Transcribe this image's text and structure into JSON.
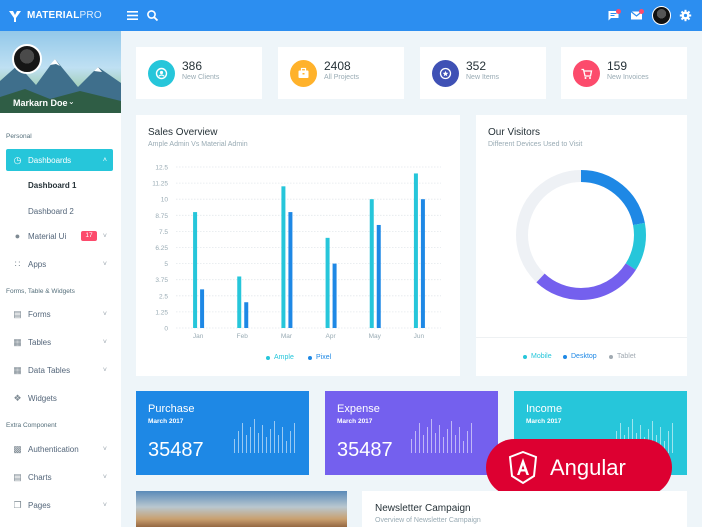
{
  "brand": {
    "name_bold": "MATERIAL",
    "name_light": "PRO"
  },
  "topbar": {
    "icons": [
      "hamburger-icon",
      "search-icon",
      "message-icon",
      "mail-icon",
      "avatar",
      "gear-icon"
    ]
  },
  "profile": {
    "name": "Markarn Doe"
  },
  "sidebar": {
    "section_personal": "Personal",
    "dashboards": "Dashboards",
    "dashboard1": "Dashboard 1",
    "dashboard2": "Dashboard 2",
    "material_ui": "Material Ui",
    "material_badge": "17",
    "apps": "Apps",
    "section_forms": "Forms, Table & Widgets",
    "forms": "Forms",
    "tables": "Tables",
    "data_tables": "Data Tables",
    "widgets": "Widgets",
    "section_extra": "Extra Component",
    "authentication": "Authentication",
    "charts": "Charts",
    "pages": "Pages"
  },
  "stats": [
    {
      "value": "386",
      "label": "New Clients",
      "color": "#26c6da"
    },
    {
      "value": "2408",
      "label": "All Projects",
      "color": "#ffb22b"
    },
    {
      "value": "352",
      "label": "New Items",
      "color": "#3f51b5"
    },
    {
      "value": "159",
      "label": "New Invoices",
      "color": "#fc4b6c"
    }
  ],
  "sales": {
    "title": "Sales Overview",
    "subtitle": "Ample Admin Vs Material Admin"
  },
  "visitors": {
    "title": "Our Visitors",
    "subtitle": "Different Devices Used to Visit"
  },
  "chart_data": [
    {
      "type": "bar",
      "categories": [
        "Jan",
        "Feb",
        "Mar",
        "Apr",
        "May",
        "Jun"
      ],
      "yticks": [
        "0",
        "1.25",
        "2.5",
        "3.75",
        "5",
        "6.25",
        "7.5",
        "8.75",
        "10",
        "11.25",
        "12.5"
      ],
      "ylim": [
        0,
        12.5
      ],
      "series": [
        {
          "name": "Ample",
          "color": "#26c6da",
          "values": [
            9,
            4,
            11,
            7,
            10,
            12
          ]
        },
        {
          "name": "Pixel",
          "color": "#1e88e5",
          "values": [
            3,
            2,
            9,
            5,
            8,
            10
          ]
        }
      ]
    },
    {
      "type": "pie",
      "donut": true,
      "slices": [
        {
          "name": "Mobile",
          "value": 12,
          "color": "#26c6da"
        },
        {
          "name": "Desktop",
          "value": 40,
          "color": "#1e88e5"
        },
        {
          "name": "Tablet",
          "value": 48,
          "color": "#eceff1"
        }
      ],
      "note": "Desktop slice rendered in blue, second purple arc"
    }
  ],
  "tiles": [
    {
      "title": "Purchase",
      "date": "March 2017",
      "value": "35487",
      "color": "#1e88e5"
    },
    {
      "title": "Expense",
      "date": "March 2017",
      "value": "35487",
      "color": "#7460ee"
    },
    {
      "title": "Income",
      "date": "March 2017",
      "value": "",
      "color": "#26c6da"
    }
  ],
  "angular": {
    "label": "Angular"
  },
  "newsletter": {
    "title": "Newsletter Campaign",
    "subtitle": "Overview of Newsletter Campaign"
  }
}
